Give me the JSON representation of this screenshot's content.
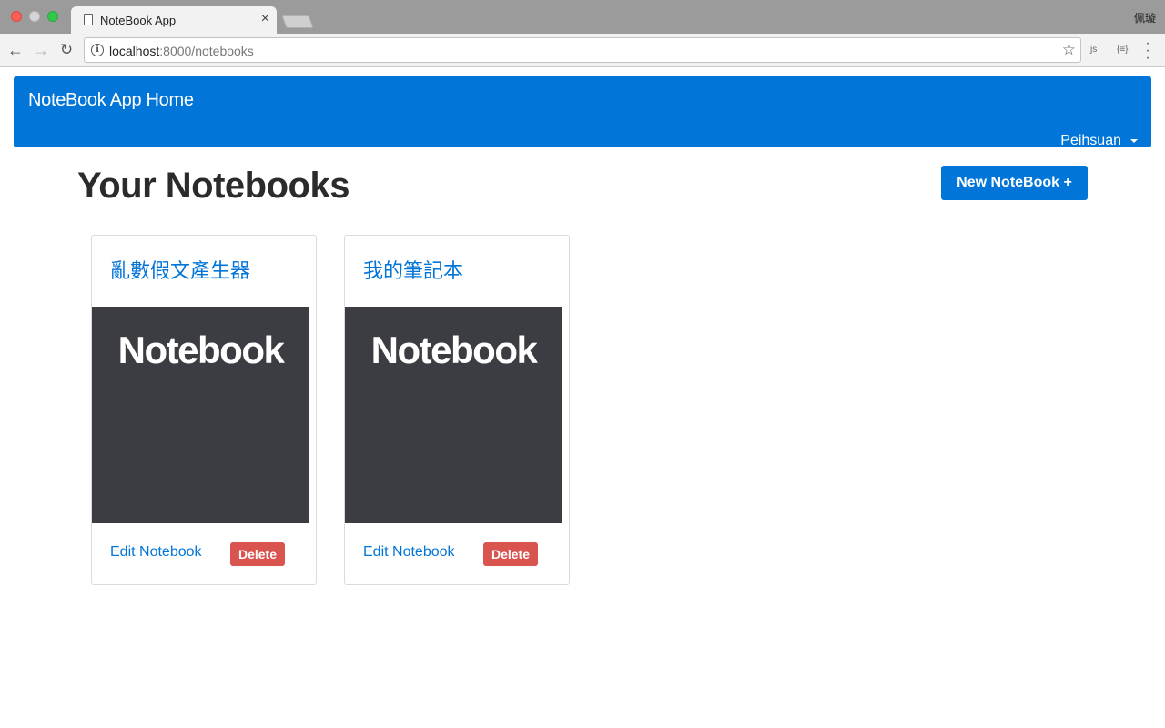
{
  "browser": {
    "tab_title": "NoteBook App",
    "tab_close": "×",
    "profile_name": "佩璇",
    "url_host": "localhost",
    "url_rest": ":8000/notebooks",
    "icons": {
      "back": "back-arrow-icon",
      "forward": "forward-arrow-icon",
      "reload": "reload-icon",
      "info": "info-icon",
      "star": "bookmark-star-icon",
      "menu": "kebab-menu-icon"
    },
    "ext_js_label": "js",
    "ext_json_label": "{≡}"
  },
  "navbar": {
    "brand": "NoteBook App Home",
    "user_name": "Peihsuan",
    "color": "#0275d8"
  },
  "main": {
    "title": "Your Notebooks",
    "new_button_label": "New NoteBook +"
  },
  "notebooks": [
    {
      "title": "亂數假文產生器",
      "image_text": "Notebook",
      "edit_label": "Edit Notebook",
      "delete_label": "Delete"
    },
    {
      "title": "我的筆記本",
      "image_text": "Notebook",
      "edit_label": "Edit Notebook",
      "delete_label": "Delete"
    }
  ],
  "colors": {
    "primary": "#0275d8",
    "danger": "#d9534f",
    "card_image_bg": "#3c3d42"
  }
}
